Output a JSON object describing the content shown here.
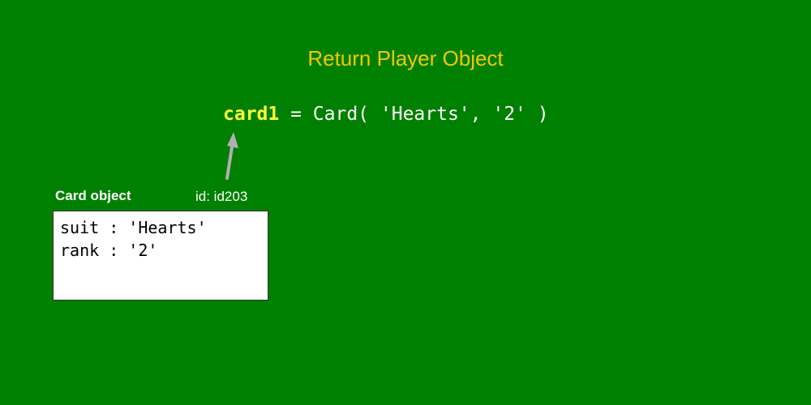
{
  "title": "Return Player Object",
  "code": {
    "variable": "card1",
    "expression": " = Card( 'Hearts', '2' )"
  },
  "object": {
    "label": "Card object",
    "id_text": "id: id203",
    "fields": [
      "suit : 'Hearts'",
      "rank : '2'"
    ]
  },
  "colors": {
    "background": "#008000",
    "title": "#f2c800",
    "variable": "#ffff3a",
    "arrow": "#b0b0b0"
  }
}
